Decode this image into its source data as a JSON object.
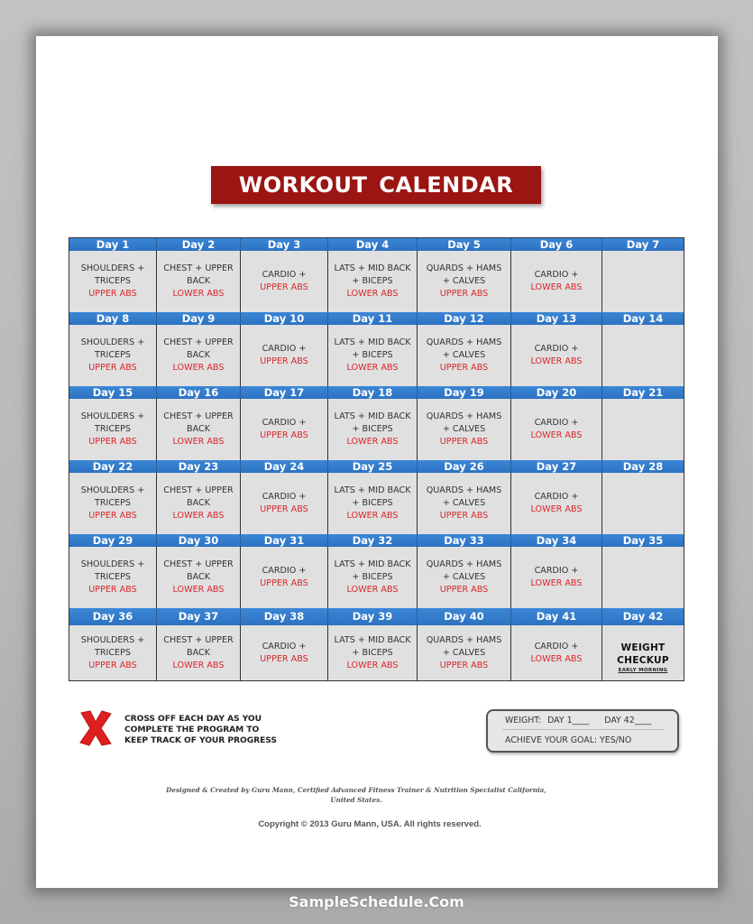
{
  "title": "WORKOUT  CALENDAR",
  "colors": {
    "title_bg": "#9b1512",
    "header_blue": "#3b86d6",
    "abs_red": "#d9262b",
    "cell_bg": "#e0e0e0"
  },
  "weeks": [
    {
      "days": [
        {
          "label": "Day 1",
          "line1": "SHOULDERS +",
          "line2": "TRICEPS",
          "abs": "UPPER ABS"
        },
        {
          "label": "Day 2",
          "line1": "CHEST + UPPER",
          "line2": "BACK",
          "abs": "LOWER ABS"
        },
        {
          "label": "Day 3",
          "line1": "CARDIO +",
          "line2": "",
          "abs": "UPPER ABS"
        },
        {
          "label": "Day 4",
          "line1": "LATS + MID BACK",
          "line2": "+ BICEPS",
          "abs": "LOWER ABS"
        },
        {
          "label": "Day 5",
          "line1": "QUARDS + HAMS",
          "line2": "+ CALVES",
          "abs": "UPPER ABS"
        },
        {
          "label": "Day 6",
          "line1": "CARDIO +",
          "line2": "",
          "abs": "LOWER ABS"
        },
        {
          "label": "Day 7",
          "line1": "",
          "line2": "",
          "abs": ""
        }
      ]
    },
    {
      "days": [
        {
          "label": "Day 8",
          "line1": "SHOULDERS +",
          "line2": "TRICEPS",
          "abs": "UPPER ABS"
        },
        {
          "label": "Day 9",
          "line1": "CHEST + UPPER",
          "line2": "BACK",
          "abs": "LOWER ABS"
        },
        {
          "label": "Day 10",
          "line1": "CARDIO +",
          "line2": "",
          "abs": "UPPER ABS"
        },
        {
          "label": "Day 11",
          "line1": "LATS + MID BACK",
          "line2": "+ BICEPS",
          "abs": "LOWER ABS"
        },
        {
          "label": "Day 12",
          "line1": "QUARDS + HAMS",
          "line2": "+ CALVES",
          "abs": "UPPER ABS"
        },
        {
          "label": "Day 13",
          "line1": "CARDIO +",
          "line2": "",
          "abs": "LOWER ABS"
        },
        {
          "label": "Day 14",
          "line1": "",
          "line2": "",
          "abs": ""
        }
      ]
    },
    {
      "days": [
        {
          "label": "Day 15",
          "line1": "SHOULDERS +",
          "line2": "TRICEPS",
          "abs": "UPPER ABS"
        },
        {
          "label": "Day 16",
          "line1": "CHEST + UPPER",
          "line2": "BACK",
          "abs": "LOWER ABS"
        },
        {
          "label": "Day 17",
          "line1": "CARDIO +",
          "line2": "",
          "abs": "UPPER ABS"
        },
        {
          "label": "Day 18",
          "line1": "LATS + MID BACK",
          "line2": "+ BICEPS",
          "abs": "LOWER ABS"
        },
        {
          "label": "Day 19",
          "line1": "QUARDS + HAMS",
          "line2": "+ CALVES",
          "abs": "UPPER ABS"
        },
        {
          "label": "Day 20",
          "line1": "CARDIO +",
          "line2": "",
          "abs": "LOWER ABS"
        },
        {
          "label": "Day 21",
          "line1": "",
          "line2": "",
          "abs": ""
        }
      ]
    },
    {
      "days": [
        {
          "label": "Day 22",
          "line1": "SHOULDERS +",
          "line2": "TRICEPS",
          "abs": "UPPER ABS"
        },
        {
          "label": "Day 23",
          "line1": "CHEST + UPPER",
          "line2": "BACK",
          "abs": "LOWER ABS"
        },
        {
          "label": "Day 24",
          "line1": "CARDIO +",
          "line2": "",
          "abs": "UPPER ABS"
        },
        {
          "label": "Day 25",
          "line1": "LATS + MID BACK",
          "line2": "+ BICEPS",
          "abs": "LOWER ABS"
        },
        {
          "label": "Day 26",
          "line1": "QUARDS + HAMS",
          "line2": "+ CALVES",
          "abs": "UPPER ABS"
        },
        {
          "label": "Day 27",
          "line1": "CARDIO +",
          "line2": "",
          "abs": "LOWER ABS"
        },
        {
          "label": "Day 28",
          "line1": "",
          "line2": "",
          "abs": ""
        }
      ]
    },
    {
      "days": [
        {
          "label": "Day 29",
          "line1": "SHOULDERS +",
          "line2": "TRICEPS",
          "abs": "UPPER ABS"
        },
        {
          "label": "Day 30",
          "line1": "CHEST + UPPER",
          "line2": "BACK",
          "abs": "LOWER ABS"
        },
        {
          "label": "Day 31",
          "line1": "CARDIO +",
          "line2": "",
          "abs": "UPPER ABS"
        },
        {
          "label": "Day 32",
          "line1": "LATS + MID BACK",
          "line2": "+ BICEPS",
          "abs": "LOWER ABS"
        },
        {
          "label": "Day 33",
          "line1": "QUARDS + HAMS",
          "line2": "+ CALVES",
          "abs": "UPPER ABS"
        },
        {
          "label": "Day 34",
          "line1": "CARDIO +",
          "line2": "",
          "abs": "LOWER ABS"
        },
        {
          "label": "Day 35",
          "line1": "",
          "line2": "",
          "abs": ""
        }
      ]
    },
    {
      "days": [
        {
          "label": "Day 36",
          "line1": "SHOULDERS +",
          "line2": "TRICEPS",
          "abs": "UPPER ABS"
        },
        {
          "label": "Day 37",
          "line1": "CHEST + UPPER",
          "line2": "BACK",
          "abs": "LOWER ABS"
        },
        {
          "label": "Day 38",
          "line1": "CARDIO +",
          "line2": "",
          "abs": "UPPER ABS"
        },
        {
          "label": "Day 39",
          "line1": "LATS + MID BACK",
          "line2": "+ BICEPS",
          "abs": "LOWER ABS"
        },
        {
          "label": "Day 40",
          "line1": "QUARDS + HAMS",
          "line2": "+ CALVES",
          "abs": "UPPER ABS"
        },
        {
          "label": "Day 41",
          "line1": "CARDIO +",
          "line2": "",
          "abs": "LOWER ABS"
        },
        {
          "label": "Day 42",
          "line1": "",
          "line2": "",
          "abs": "",
          "special": [
            "WEIGHT",
            "CHECKUP",
            "EARLY MORNING"
          ]
        }
      ]
    }
  ],
  "legend": {
    "icon": "red-x-icon",
    "lines": [
      "CROSS OFF EACH DAY AS YOU",
      "COMPLETE THE PROGRAM TO",
      "KEEP TRACK OF YOUR PROGRESS"
    ]
  },
  "weight_box": {
    "weight_label": "WEIGHT:",
    "day1": "DAY 1____",
    "day42": "DAY 42____",
    "goal": "ACHIEVE YOUR GOAL:  YES/NO"
  },
  "footer": {
    "credit_line1": "Designed & Created by Guru Mann, Certified Advanced Fitness Trainer & Nutrition Specialist California,",
    "credit_line2": "United States.",
    "copyright": "Copyright © 2013 Guru Mann, USA. All rights reserved."
  },
  "watermark": "SampleSchedule.Com"
}
